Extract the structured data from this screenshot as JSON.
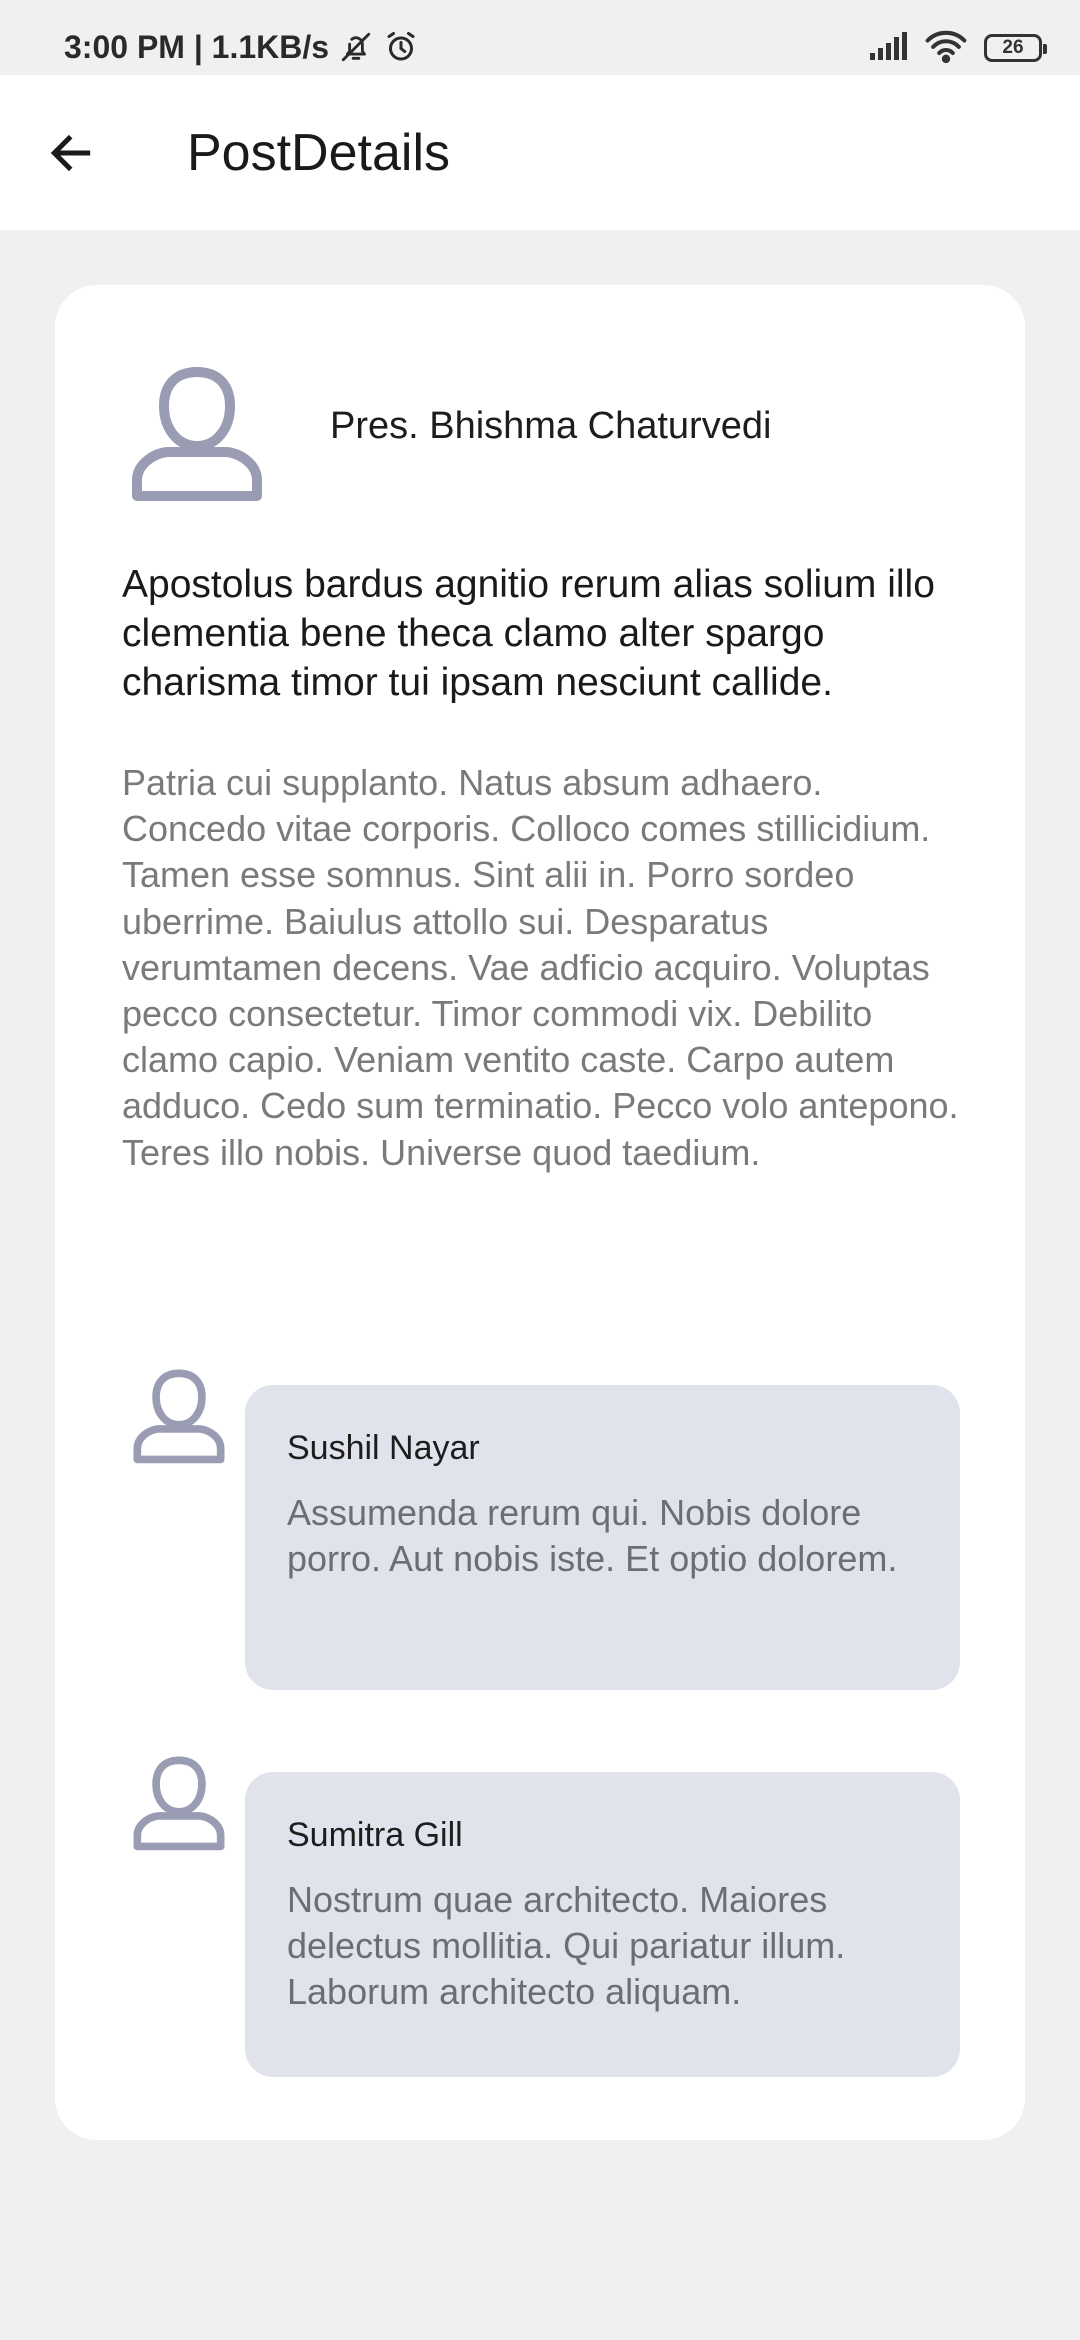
{
  "status_bar": {
    "time_speed": "3:00 PM | 1.1KB/s",
    "battery": "26",
    "icons": [
      "bell-off-icon",
      "alarm-icon",
      "signal-icon",
      "wifi-icon",
      "battery-icon"
    ]
  },
  "app_bar": {
    "title": "PostDetails",
    "back_icon": "arrow-left-icon"
  },
  "post": {
    "author": "Pres. Bhishma Chaturvedi",
    "title": "Apostolus bardus agnitio rerum alias solium illo clementia bene theca clamo alter spargo charisma timor tui ipsam nesciunt callide.",
    "body": "Patria cui supplanto. Natus absum adhaero. Concedo vitae corporis. Colloco comes stillicidium. Tamen esse somnus. Sint alii in. Porro sordeo uberrime. Baiulus attollo sui. Desparatus verumtamen decens. Vae adficio acquiro. Voluptas pecco consectetur. Timor commodi vix. Debilito clamo capio. Veniam ventito caste. Carpo autem adduco. Cedo sum terminatio. Pecco volo antepono. Teres illo nobis. Universe quod taedium."
  },
  "comments": [
    {
      "author": "Sushil Nayar",
      "text": "Assumenda rerum qui. Nobis dolore porro. Aut nobis iste. Et optio dolorem."
    },
    {
      "author": "Sumitra Gill",
      "text": "Nostrum quae architecto. Maiores delectus mollitia. Qui pariatur illum. Laborum architecto aliquam."
    }
  ],
  "colors": {
    "background": "#f0f0f0",
    "card": "#ffffff",
    "comment_bubble": "#e0e3ec",
    "avatar": "#9a9cb4",
    "body_text": "#7a7a7a"
  }
}
